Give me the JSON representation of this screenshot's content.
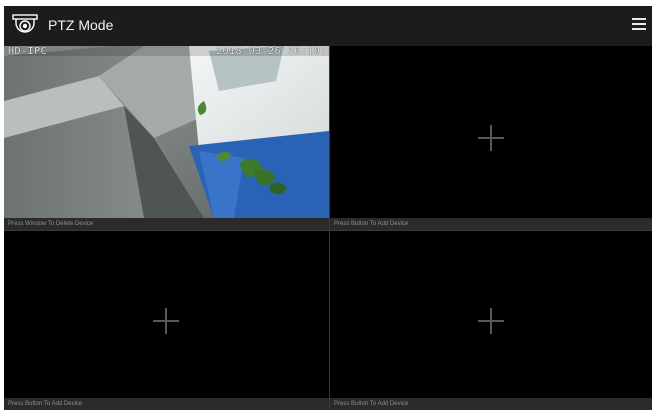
{
  "header": {
    "title": "PTZ Mode",
    "camera_icon": "dome-camera-icon",
    "menu_icon": "hamburger-menu-icon"
  },
  "panes": [
    {
      "osd_name": "HD-IPC",
      "osd_timestamp": "2018-03-26  16:10:13",
      "footer": "Press Window To Delete Device"
    },
    {
      "footer": "Press Button To Add Device",
      "icon": "add-plus-icon"
    },
    {
      "footer": "Press Button To Add Device",
      "icon": "add-plus-icon"
    },
    {
      "footer": "Press Button To Add Device",
      "icon": "add-plus-icon"
    }
  ],
  "colors": {
    "background": "#0a0a0a",
    "topbar": "#1c1c1c",
    "footer_bar": "#2b2b2b"
  }
}
